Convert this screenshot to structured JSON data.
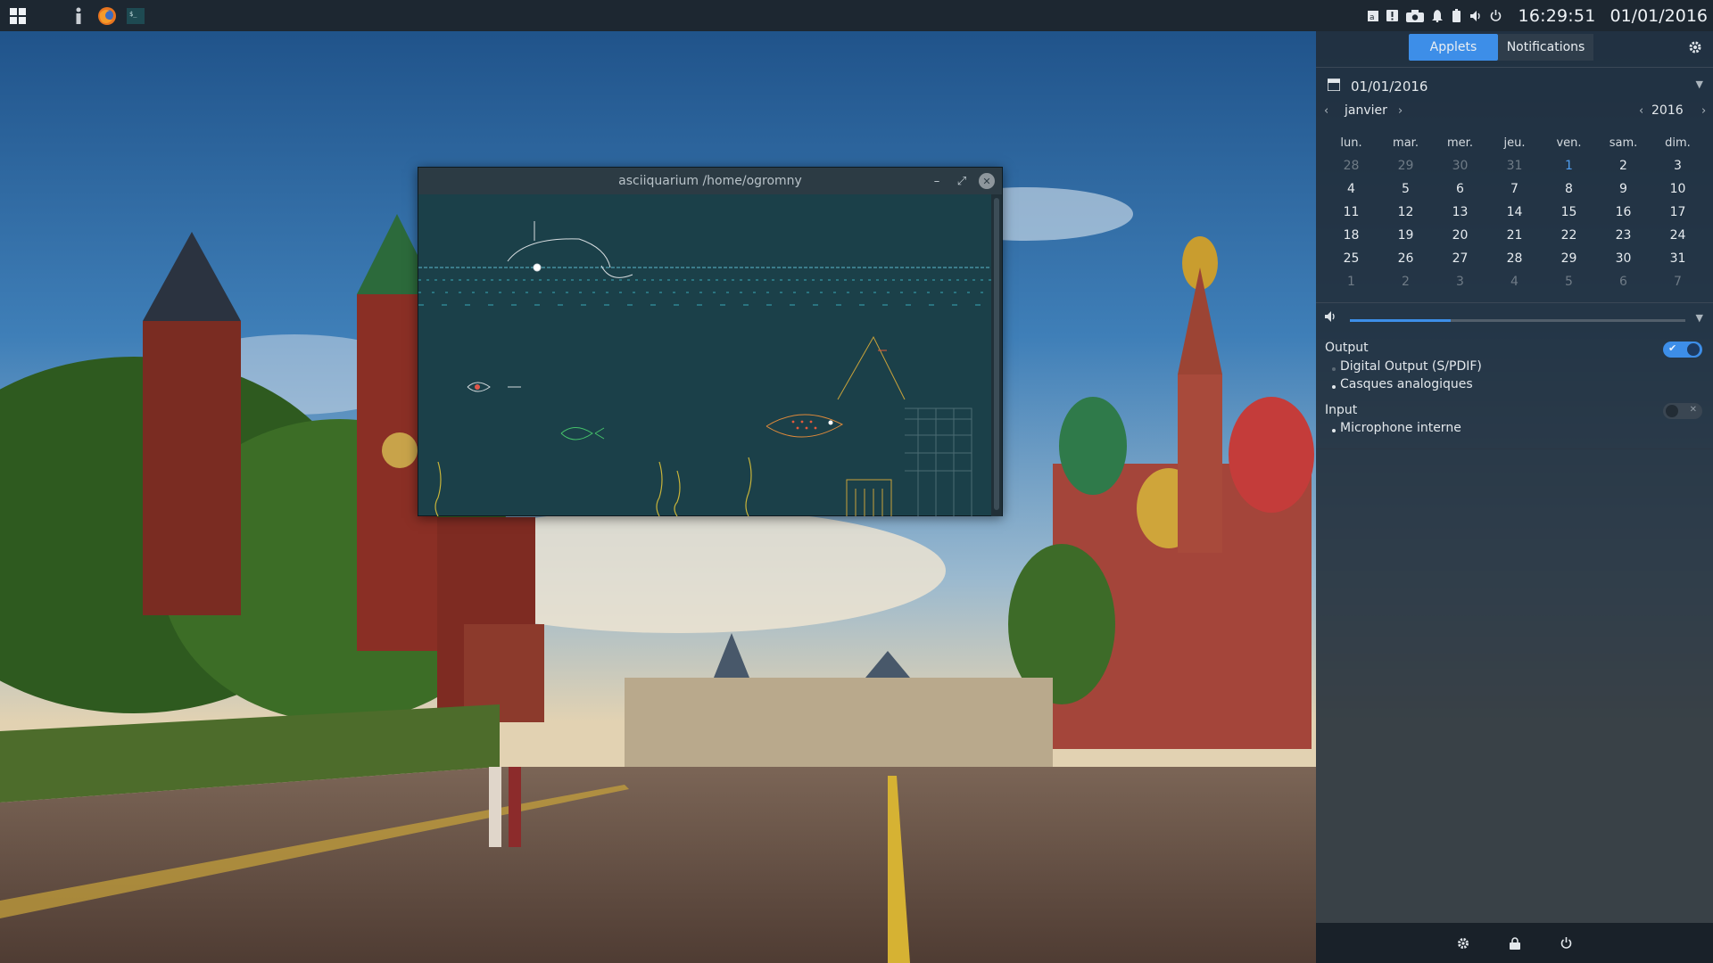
{
  "taskbar": {
    "apps_icon": "apps-grid-icon",
    "launchers": [
      "info-icon",
      "firefox-icon",
      "terminal-icon"
    ],
    "tray_icons": [
      "keyboard-layout-icon",
      "notification-box-icon",
      "camera-icon",
      "bell-icon",
      "battery-icon",
      "volume-icon",
      "power-icon"
    ],
    "clock": "16:29:51",
    "date": "01/01/2016"
  },
  "terminal": {
    "title": "asciiquarium  /home/ogromny",
    "content": "ascii aquarium animation",
    "bg_color": "#1b4049"
  },
  "panel": {
    "tabs": [
      "Applets",
      "Notifications"
    ],
    "active_tab": "Applets",
    "date": "01/01/2016",
    "month": "janvier",
    "year": "2016",
    "weekdays": [
      "lun.",
      "mar.",
      "mer.",
      "jeu.",
      "ven.",
      "sam.",
      "dim."
    ],
    "weeks": [
      [
        "28",
        "29",
        "30",
        "31",
        "1",
        "2",
        "3"
      ],
      [
        "4",
        "5",
        "6",
        "7",
        "8",
        "9",
        "10"
      ],
      [
        "11",
        "12",
        "13",
        "14",
        "15",
        "16",
        "17"
      ],
      [
        "18",
        "19",
        "20",
        "21",
        "22",
        "23",
        "24"
      ],
      [
        "25",
        "26",
        "27",
        "28",
        "29",
        "30",
        "31"
      ],
      [
        "1",
        "2",
        "3",
        "4",
        "5",
        "6",
        "7"
      ]
    ],
    "today": "1",
    "volume_level": 0.3,
    "output_label": "Output",
    "output_devices": [
      "Digital Output (S/PDIF)",
      "Casques analogiques"
    ],
    "output_enabled": true,
    "input_label": "Input",
    "input_devices": [
      "Microphone interne"
    ],
    "input_enabled": false,
    "bottom_buttons": [
      "settings-icon",
      "lock-icon",
      "power-icon"
    ]
  },
  "colors": {
    "accent": "#3d8ee8",
    "panel_bg": "#212c38",
    "taskbar_bg": "#1d2731"
  }
}
